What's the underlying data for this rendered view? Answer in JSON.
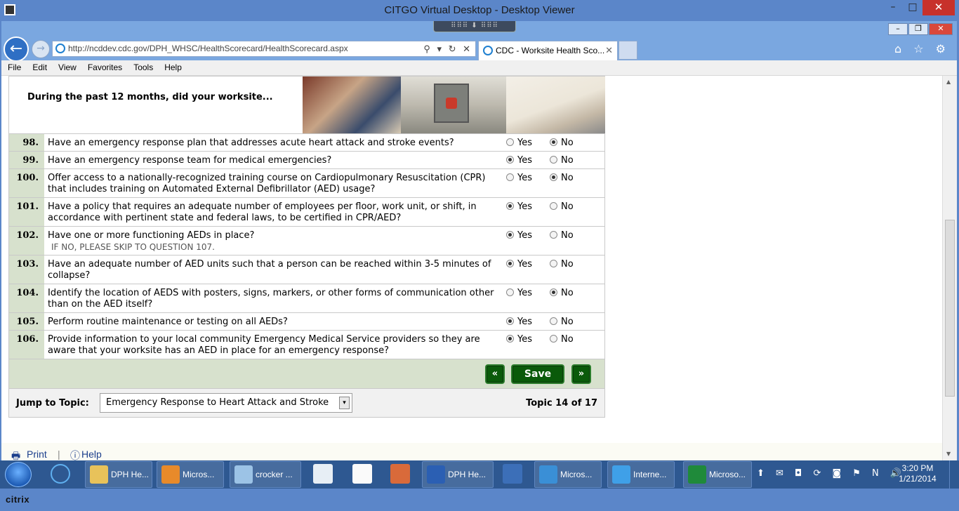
{
  "outer_window": {
    "title": "CITGO Virtual Desktop - Desktop Viewer",
    "minimize": "–",
    "maximize": "□",
    "close": "✕",
    "toolbar_handle": "⠿⠿⠿ ⬇ ⠿⠿⠿"
  },
  "browser": {
    "address": "http://ncddev.cdc.gov/DPH_WHSC/HealthScorecard/HealthScorecard.aspx",
    "tab_title": "CDC - Worksite Health Sco...",
    "tab_close": "✕",
    "back": "←",
    "forward": "→",
    "addr_tools": "⚲ ▾ ↻ ✕",
    "right_icons": "⌂ ☆ ⚙",
    "win_min": "–",
    "win_max": "❐",
    "win_close": "✕",
    "menu": [
      "File",
      "Edit",
      "View",
      "Favorites",
      "Tools",
      "Help"
    ]
  },
  "page": {
    "banner_text": "During the past 12 months, did your worksite...",
    "yes_label": "Yes",
    "no_label": "No",
    "questions": [
      {
        "num": "98.",
        "text": "Have an emergency response plan that addresses acute heart attack and stroke events?",
        "note": "",
        "answer": "No"
      },
      {
        "num": "99.",
        "text": "Have an emergency response team for medical emergencies?",
        "note": "",
        "answer": "Yes"
      },
      {
        "num": "100.",
        "text": "Offer access to a nationally-recognized training course on Cardiopulmonary Resuscitation (CPR) that includes training on Automated External Defibrillator (AED) usage?",
        "note": "",
        "answer": "No"
      },
      {
        "num": "101.",
        "text": "Have a policy that requires an adequate number of employees per floor, work unit, or shift, in accordance with pertinent state and federal laws, to be certified in CPR/AED?",
        "note": "",
        "answer": "Yes"
      },
      {
        "num": "102.",
        "text": "Have one or more functioning AEDs in place?",
        "note": "IF NO, PLEASE SKIP TO QUESTION 107.",
        "answer": "Yes"
      },
      {
        "num": "103.",
        "text": "Have an adequate number of AED units such that a person can be reached within 3-5 minutes of collapse?",
        "note": "",
        "answer": "Yes"
      },
      {
        "num": "104.",
        "text": "Identify the location of AEDS with posters, signs, markers, or other forms of communication other than on the AED itself?",
        "note": "",
        "answer": "No"
      },
      {
        "num": "105.",
        "text": "Perform routine maintenance or testing on all AEDs?",
        "note": "",
        "answer": "Yes"
      },
      {
        "num": "106.",
        "text": "Provide information to your local community Emergency Medical Service providers so they are aware that your worksite has an AED in place for an emergency response?",
        "note": "",
        "answer": "Yes"
      }
    ],
    "prev_label": "«",
    "save_label": "Save",
    "next_label": "»",
    "jump_label": "Jump to Topic:",
    "jump_value": "Emergency Response to Heart Attack and Stroke",
    "jump_arrow": "▾",
    "topic_count": "Topic 14 of 17",
    "print_label": "Print",
    "help_label": "Help"
  },
  "taskbar": {
    "items": [
      {
        "label": "DPH He...",
        "icon": "folder-icon",
        "color": "#e8c25a"
      },
      {
        "label": "Micros...",
        "icon": "outlook-icon",
        "color": "#e88a2a"
      },
      {
        "label": "crocker ...",
        "icon": "notepad-icon",
        "color": "#9cc3e6"
      },
      {
        "label": "DPH He...",
        "icon": "word-icon",
        "color": "#2b5fb3"
      },
      {
        "label": "Micros...",
        "icon": "lync-icon",
        "color": "#3a8fd6"
      },
      {
        "label": "Interne...",
        "icon": "ie-icon",
        "color": "#3fa0e8"
      },
      {
        "label": "Microso...",
        "icon": "excel-icon",
        "color": "#1f8a3a"
      }
    ],
    "time": "3:20 PM",
    "date": "1/21/2014",
    "tray": "⬆ ✉ ◘ ⟳ ◙ ⚑ N 🔊"
  },
  "citrix": {
    "logo": "citrix"
  }
}
